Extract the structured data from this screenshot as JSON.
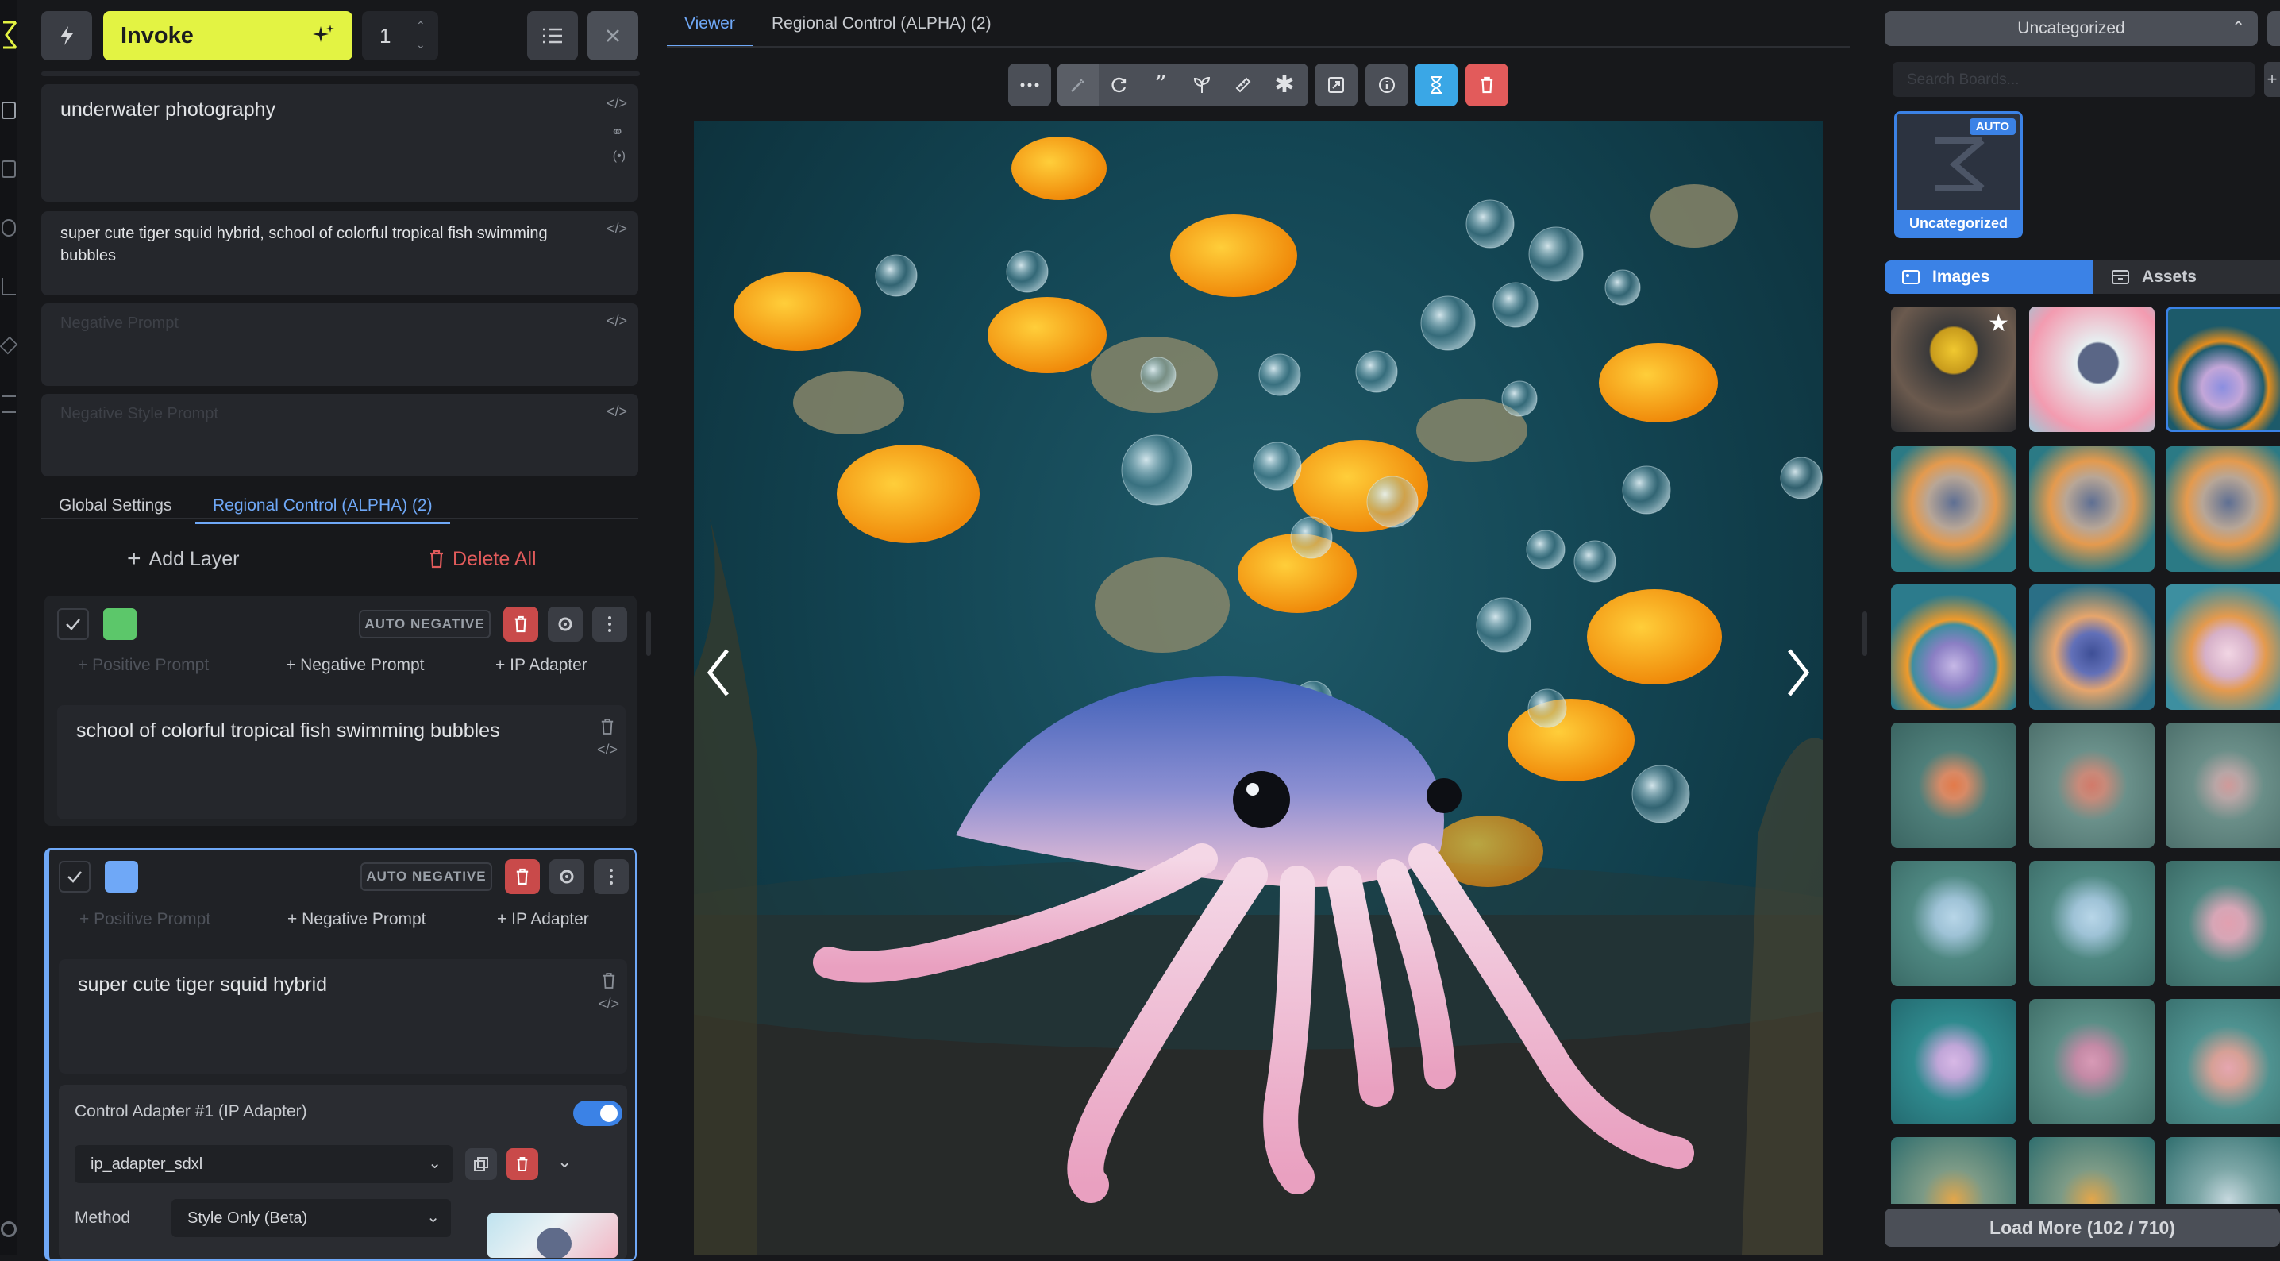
{
  "colors": {
    "invoke_yellow": "#e3f343",
    "accent_blue": "#6fa8f7",
    "delete_red": "#e25b5b",
    "background": "#17181b"
  },
  "top": {
    "invoke_label": "Invoke",
    "iterations_value": "1"
  },
  "prompts": {
    "positive": "underwater photography",
    "style": "super cute tiger squid hybrid, school of colorful tropical fish swimming bubbles",
    "negative_placeholder": "Negative Prompt",
    "negative_style_placeholder": "Negative Style Prompt"
  },
  "tabs_left": {
    "global": "Global Settings",
    "regional": "Regional Control (ALPHA) (2)"
  },
  "layers_toolbar": {
    "add": "Add Layer",
    "delete_all": "Delete All"
  },
  "layers": [
    {
      "color": "#5cc76a",
      "auto_negative": "AUTO NEGATIVE",
      "positive_btn": "Positive Prompt",
      "negative_btn": "Negative Prompt",
      "ip_btn": "IP Adapter",
      "prompt": "school of colorful tropical fish swimming bubbles"
    },
    {
      "color": "#6fa8f7",
      "auto_negative": "AUTO NEGATIVE",
      "positive_btn": "Positive Prompt",
      "negative_btn": "Negative Prompt",
      "ip_btn": "IP Adapter",
      "prompt": "super cute tiger squid hybrid",
      "adapter": {
        "title": "Control Adapter #1 (IP Adapter)",
        "model": "ip_adapter_sdxl",
        "method_label": "Method",
        "method_value": "Style Only (Beta)",
        "enabled": true
      }
    }
  ],
  "center_tabs": {
    "viewer": "Viewer",
    "regional": "Regional Control (ALPHA) (2)"
  },
  "gallery": {
    "board_select": "Uncategorized",
    "search_placeholder": "Search Boards...",
    "board_card_label": "Uncategorized",
    "board_badge": "AUTO",
    "tab_images": "Images",
    "tab_assets": "Assets",
    "load_more": "Load More (102 / 710)"
  }
}
